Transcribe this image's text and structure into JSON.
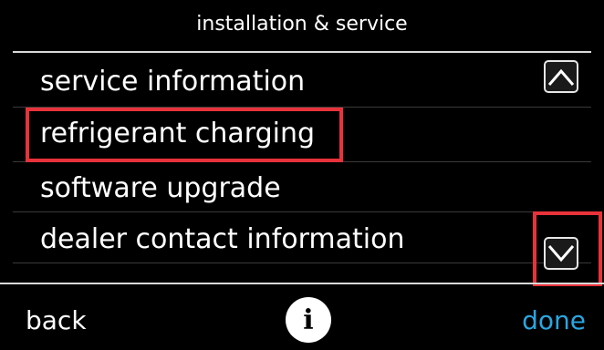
{
  "header": {
    "title": "installation & service"
  },
  "menu": {
    "items": [
      {
        "label": "service information"
      },
      {
        "label": "refrigerant charging"
      },
      {
        "label": "software upgrade"
      },
      {
        "label": "dealer contact information"
      }
    ],
    "highlighted_index": 1
  },
  "scroll": {
    "up_icon": "chevron-up-icon",
    "down_icon": "chevron-down-icon"
  },
  "footer": {
    "back_label": "back",
    "info_label": "i",
    "done_label": "done"
  },
  "colors": {
    "background": "#000000",
    "text": "#ffffff",
    "accent_done": "#2aa6e0",
    "highlight": "#e8323b"
  }
}
